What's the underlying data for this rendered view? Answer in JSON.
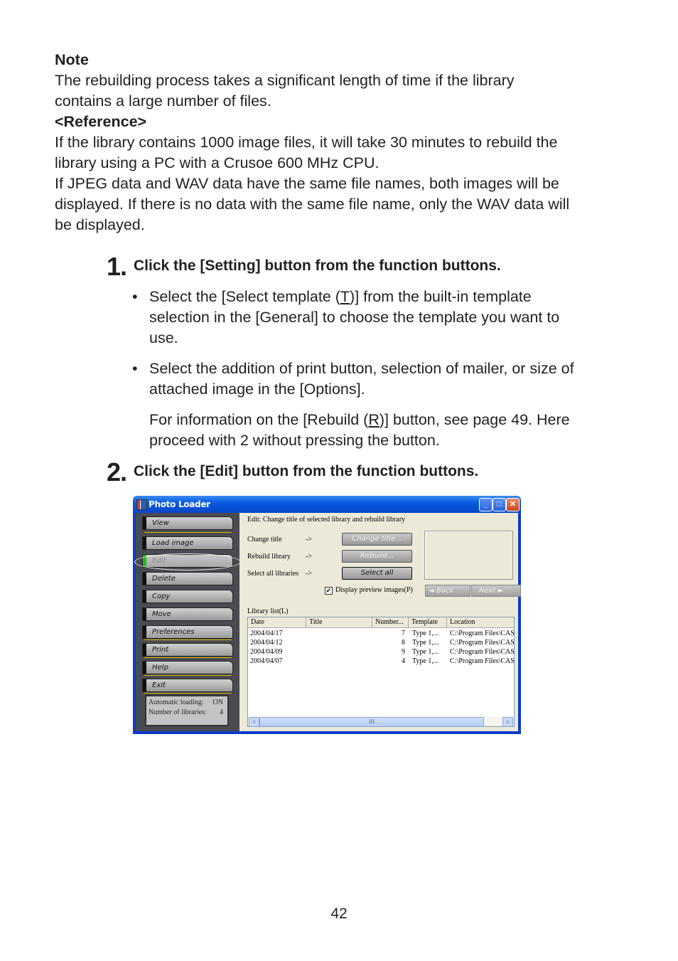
{
  "note": {
    "heading": "Note",
    "line1": "The rebuilding process takes a significant length of time if the library",
    "line2": "contains a large number of files.",
    "reference_heading": "<Reference>",
    "ref1": "If the library contains 1000 image files, it will take 30 minutes to rebuild the",
    "ref2": "library using a PC with a Crusoe 600 MHz CPU.",
    "ref3": "If JPEG data and WAV data have the same file names, both images will be",
    "ref4": "displayed. If there is no data with the same file name, only the WAV data will",
    "ref5": "be displayed."
  },
  "steps": [
    {
      "number": "1.",
      "text": "Click the [Setting] button from the function buttons.",
      "bullets": [
        {
          "pre": "Select the [Select template (",
          "key": "T",
          "post": ")] from the built-in template",
          "line2": "selection in the [General] to choose the template you want to",
          "line3": "use."
        },
        {
          "line1": "Select the addition of print button, selection of mailer, or size of",
          "line2": "attached image in the [Options]."
        }
      ],
      "info": {
        "pre": "For information on the [Rebuild (",
        "key": "R",
        "post": ")] button, see page 49. Here",
        "line2": "proceed with 2 without pressing the button."
      }
    },
    {
      "number": "2.",
      "text": "Click the [Edit] button from the function buttons."
    }
  ],
  "window": {
    "title": "Photo Loader",
    "controls": {
      "minimize": "_",
      "maximize": "□",
      "close": "✕"
    },
    "function_buttons": [
      "View",
      "Load image",
      "Edit",
      "Delete",
      "Copy",
      "Move",
      "Preferences",
      "Print",
      "Help",
      "Exit"
    ],
    "active_button": "Edit",
    "status": {
      "auto_loading_label": "Automatic loading:",
      "auto_loading_value": "ON",
      "num_libraries_label": "Number of libraries:",
      "num_libraries_value": "4"
    },
    "edit_header": "Edit: Change title of selected library and rebuild library",
    "actions": [
      {
        "label": "Change title",
        "arrow": "->",
        "button": "Change title...",
        "enabled": false
      },
      {
        "label": "Rebuild library",
        "arrow": "->",
        "button": "Rebuild...",
        "enabled": false
      },
      {
        "label": "Select all libraries",
        "arrow": "->",
        "button": "Select all",
        "enabled": true
      }
    ],
    "preview_checkbox": {
      "label": "Display preview images(P)",
      "checked": true
    },
    "nav": {
      "back": "◄  Back",
      "next": "Next  ►"
    },
    "library_list": {
      "label": "Library list(L)",
      "columns": [
        "Date",
        "Title",
        "Number...",
        "Template",
        "Location"
      ],
      "rows": [
        {
          "date": "2004/04/17",
          "title": "",
          "number": "7",
          "template": "Type 1,...",
          "location": "C:\\Program Files\\CAS"
        },
        {
          "date": "2004/04/12",
          "title": "",
          "number": "8",
          "template": "Type 1,...",
          "location": "C:\\Program Files\\CAS"
        },
        {
          "date": "2004/04/09",
          "title": "",
          "number": "9",
          "template": "Type 1,...",
          "location": "C:\\Program Files\\CAS"
        },
        {
          "date": "2004/04/07",
          "title": "",
          "number": "4",
          "template": "Type 1,...",
          "location": "C:\\Program Files\\CAS"
        }
      ],
      "scroll": {
        "left": "<",
        "right": ">",
        "grip": "III"
      }
    }
  },
  "page_number": "42"
}
